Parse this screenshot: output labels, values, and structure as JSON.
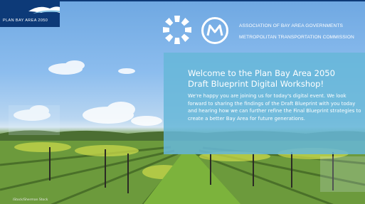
{
  "branding": {
    "plan_logo_text": "PLAN BAY AREA 2050",
    "org_line1": "ASSOCIATION OF BAY AREA GOVERNMENTS",
    "org_line2": "METROPOLITAN TRANSPORTATION COMMISSION",
    "mtc_monogram": "MT",
    "logo_color": "#0d3a78"
  },
  "welcome": {
    "title_line1": "Welcome to the Plan Bay Area 2050",
    "title_line2": "Draft Blueprint Digital Workshop!",
    "body": "We're happy you are joining us for today's digital event. We look forward to sharing the findings of the Draft Blueprint with you today and hearing how we can further refine the Final Blueprint strategies to create a better Bay Area for future generations.",
    "panel_color": "#66b7d8"
  },
  "photo": {
    "credit": "iStock/Sherman Stock"
  },
  "icons": [
    "abag-sun-icon",
    "mtc-monogram-icon",
    "plan-bay-area-hills-icon"
  ]
}
